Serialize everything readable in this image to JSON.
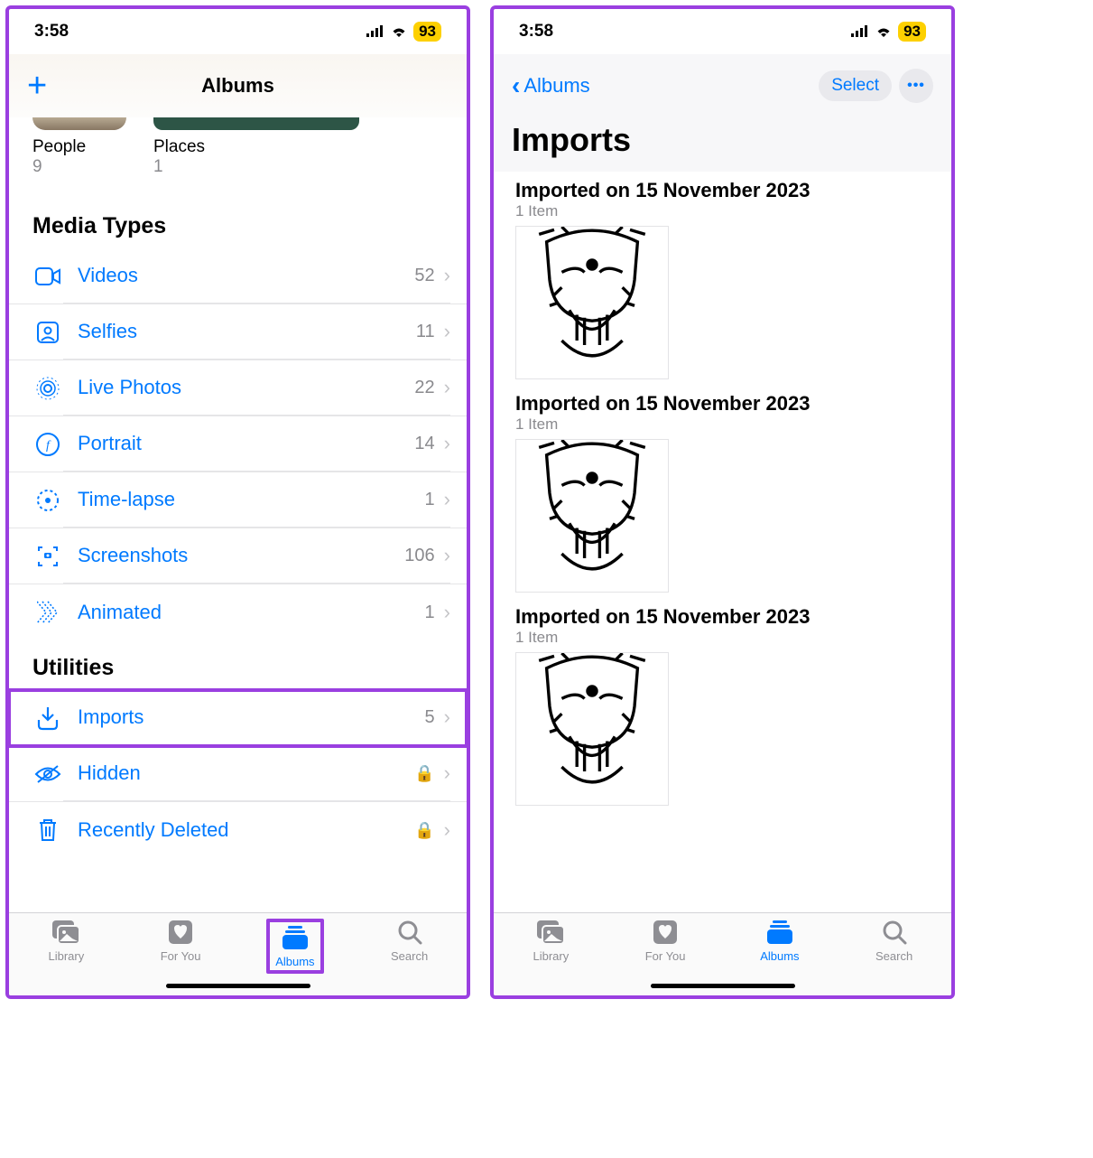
{
  "status": {
    "time": "3:58",
    "battery": "93"
  },
  "left": {
    "nav_title": "Albums",
    "people": {
      "title": "People",
      "count": "9"
    },
    "places": {
      "title": "Places",
      "count": "1"
    },
    "media_header": "Media Types",
    "media": [
      {
        "label": "Videos",
        "count": "52"
      },
      {
        "label": "Selfies",
        "count": "11"
      },
      {
        "label": "Live Photos",
        "count": "22"
      },
      {
        "label": "Portrait",
        "count": "14"
      },
      {
        "label": "Time-lapse",
        "count": "1"
      },
      {
        "label": "Screenshots",
        "count": "106"
      },
      {
        "label": "Animated",
        "count": "1"
      }
    ],
    "utilities_header": "Utilities",
    "utilities": [
      {
        "label": "Imports",
        "count": "5"
      },
      {
        "label": "Hidden"
      },
      {
        "label": "Recently Deleted"
      }
    ],
    "tabs": {
      "library": "Library",
      "foryou": "For You",
      "albums": "Albums",
      "search": "Search"
    }
  },
  "right": {
    "back": "Albums",
    "select": "Select",
    "title": "Imports",
    "groups": [
      {
        "title": "Imported on 15 November 2023",
        "sub": "1 Item"
      },
      {
        "title": "Imported on 15 November 2023",
        "sub": "1 Item"
      },
      {
        "title": "Imported on 15 November 2023",
        "sub": "1 Item"
      }
    ],
    "tabs": {
      "library": "Library",
      "foryou": "For You",
      "albums": "Albums",
      "search": "Search"
    }
  }
}
